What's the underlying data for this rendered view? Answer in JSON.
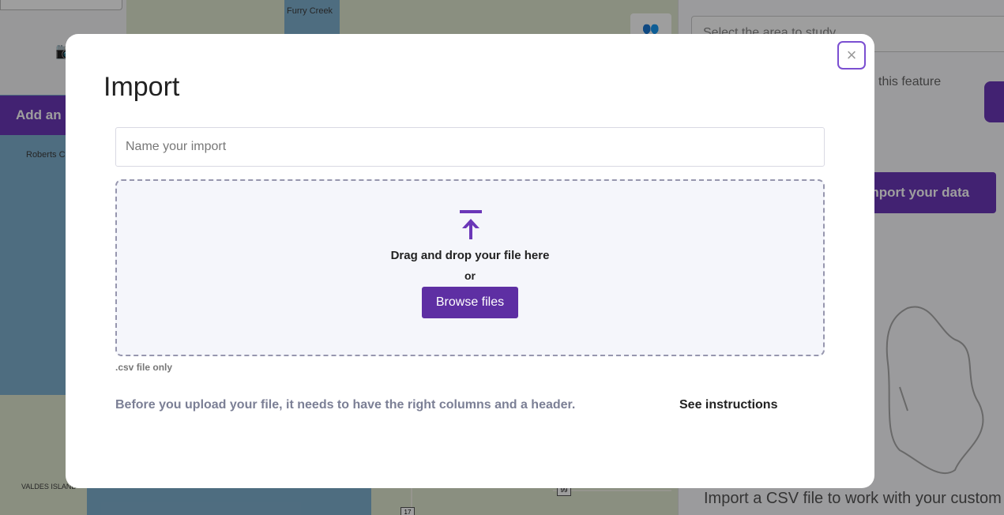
{
  "background": {
    "map": {
      "labels": {
        "furry_creek": "Furry Creek",
        "roberts": "Roberts C",
        "valdes": "VALDES ISLAND"
      },
      "route_shields": [
        "99",
        "17"
      ]
    },
    "add_button_label": "Add an",
    "right_panel": {
      "select_placeholder": "Select the area to study",
      "feature_hint": "this feature",
      "import_button_label": "Import your data",
      "caption": "Import a CSV file to work with your custom"
    }
  },
  "modal": {
    "title": "Import",
    "close_symbol": "×",
    "name_placeholder": "Name your import",
    "dropzone": {
      "drag_text": "Drag and drop your file here",
      "or_text": "or",
      "browse_label": "Browse files"
    },
    "csv_note": ".csv file only",
    "before_text": "Before you upload your file, it needs to have the right columns and a header.",
    "see_instructions": "See instructions"
  },
  "colors": {
    "accent": "#5e2fa3",
    "close_border": "#7b4fd1"
  }
}
